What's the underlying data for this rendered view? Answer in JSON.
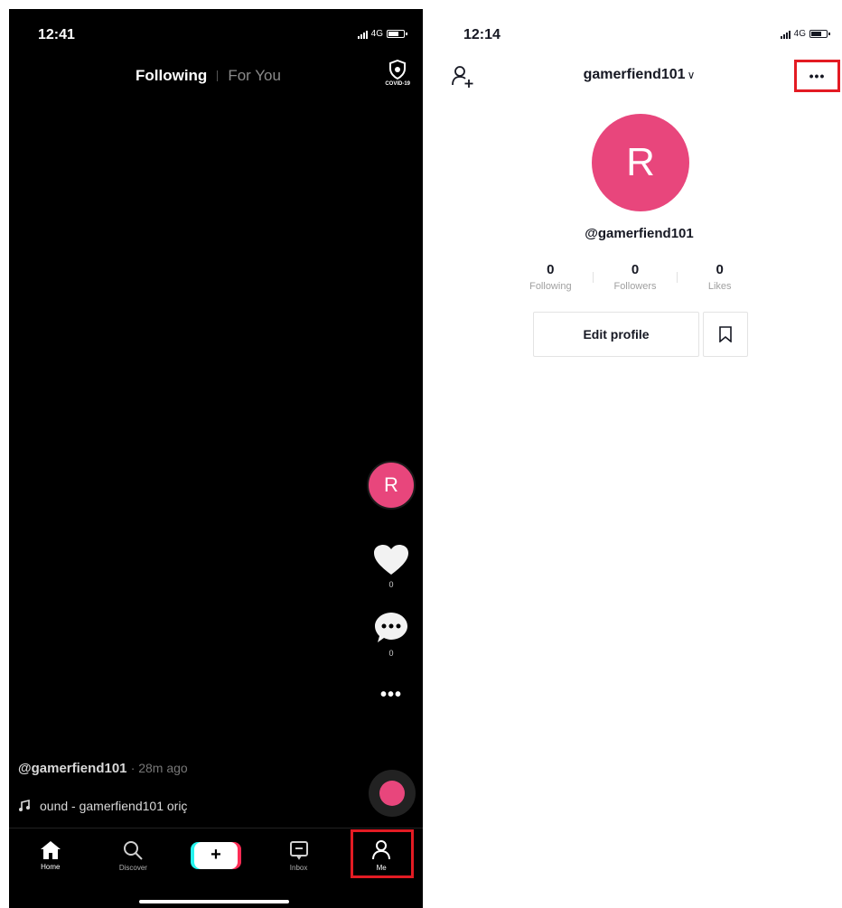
{
  "left_screen": {
    "status_time": "12:41",
    "network": "4G",
    "tabs": {
      "following": "Following",
      "for_you": "For You"
    },
    "covid_label": "COVID-19",
    "creator_avatar_letter": "R",
    "like_count": "0",
    "comment_count": "0",
    "more_label": "•••",
    "caption_username": "@gamerfiend101",
    "caption_time": "· 28m ago",
    "sound_text": "ound - gamerfiend101   oriç",
    "nav": {
      "home": "Home",
      "discover": "Discover",
      "create": "+",
      "inbox": "Inbox",
      "me": "Me"
    }
  },
  "right_screen": {
    "status_time": "12:14",
    "network": "4G",
    "header_username": "gamerfiend101",
    "more_label": "•••",
    "avatar_letter": "R",
    "handle": "@gamerfiend101",
    "stats": [
      {
        "value": "0",
        "label": "Following"
      },
      {
        "value": "0",
        "label": "Followers"
      },
      {
        "value": "0",
        "label": "Likes"
      }
    ],
    "edit_profile_label": "Edit profile"
  },
  "colors": {
    "accent_pink": "#e8467c",
    "highlight_red": "#e31b23",
    "dark_bg": "#000000"
  }
}
